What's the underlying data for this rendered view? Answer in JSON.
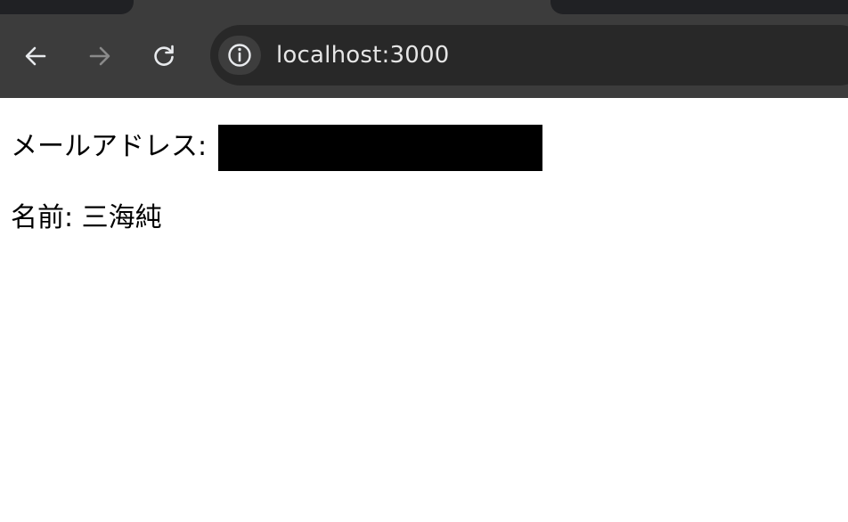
{
  "browser": {
    "url": "localhost:3000",
    "icons": {
      "back": "arrow-left-icon",
      "forward": "arrow-right-icon",
      "reload": "reload-icon",
      "site_info": "info-icon"
    },
    "colors": {
      "chrome_bg": "#3c3c3c",
      "tab_bg": "#202124",
      "omnibox_bg": "#282828",
      "icon_active": "#e8eaed",
      "icon_disabled": "#8a8a8a"
    }
  },
  "page": {
    "email_label": "メールアドレス:",
    "name_label": "名前:",
    "name_value": "三海純"
  }
}
